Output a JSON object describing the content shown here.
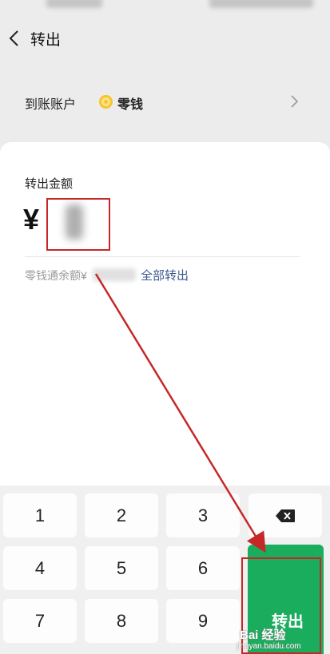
{
  "header": {
    "title": "转出"
  },
  "account": {
    "label": "到账账户",
    "value": "零钱"
  },
  "amount": {
    "label": "转出金额",
    "currency": "¥"
  },
  "balance": {
    "text": "零钱通余额¥",
    "all_out": "全部转出"
  },
  "keypad": {
    "keys": [
      "1",
      "2",
      "3",
      "4",
      "5",
      "6",
      "7",
      "8",
      "9"
    ],
    "confirm_label": "转出"
  },
  "watermark": {
    "top": "Bai 经验",
    "bottom": "jingyan.baidu.com"
  },
  "colors": {
    "green": "#1aad5e",
    "link": "#3d5a8f",
    "annotation": "#c62828"
  },
  "icons": {
    "back": "chevron-left-icon",
    "arrow": "chevron-right-icon",
    "delete": "backspace-icon",
    "coin": "coin-icon"
  }
}
